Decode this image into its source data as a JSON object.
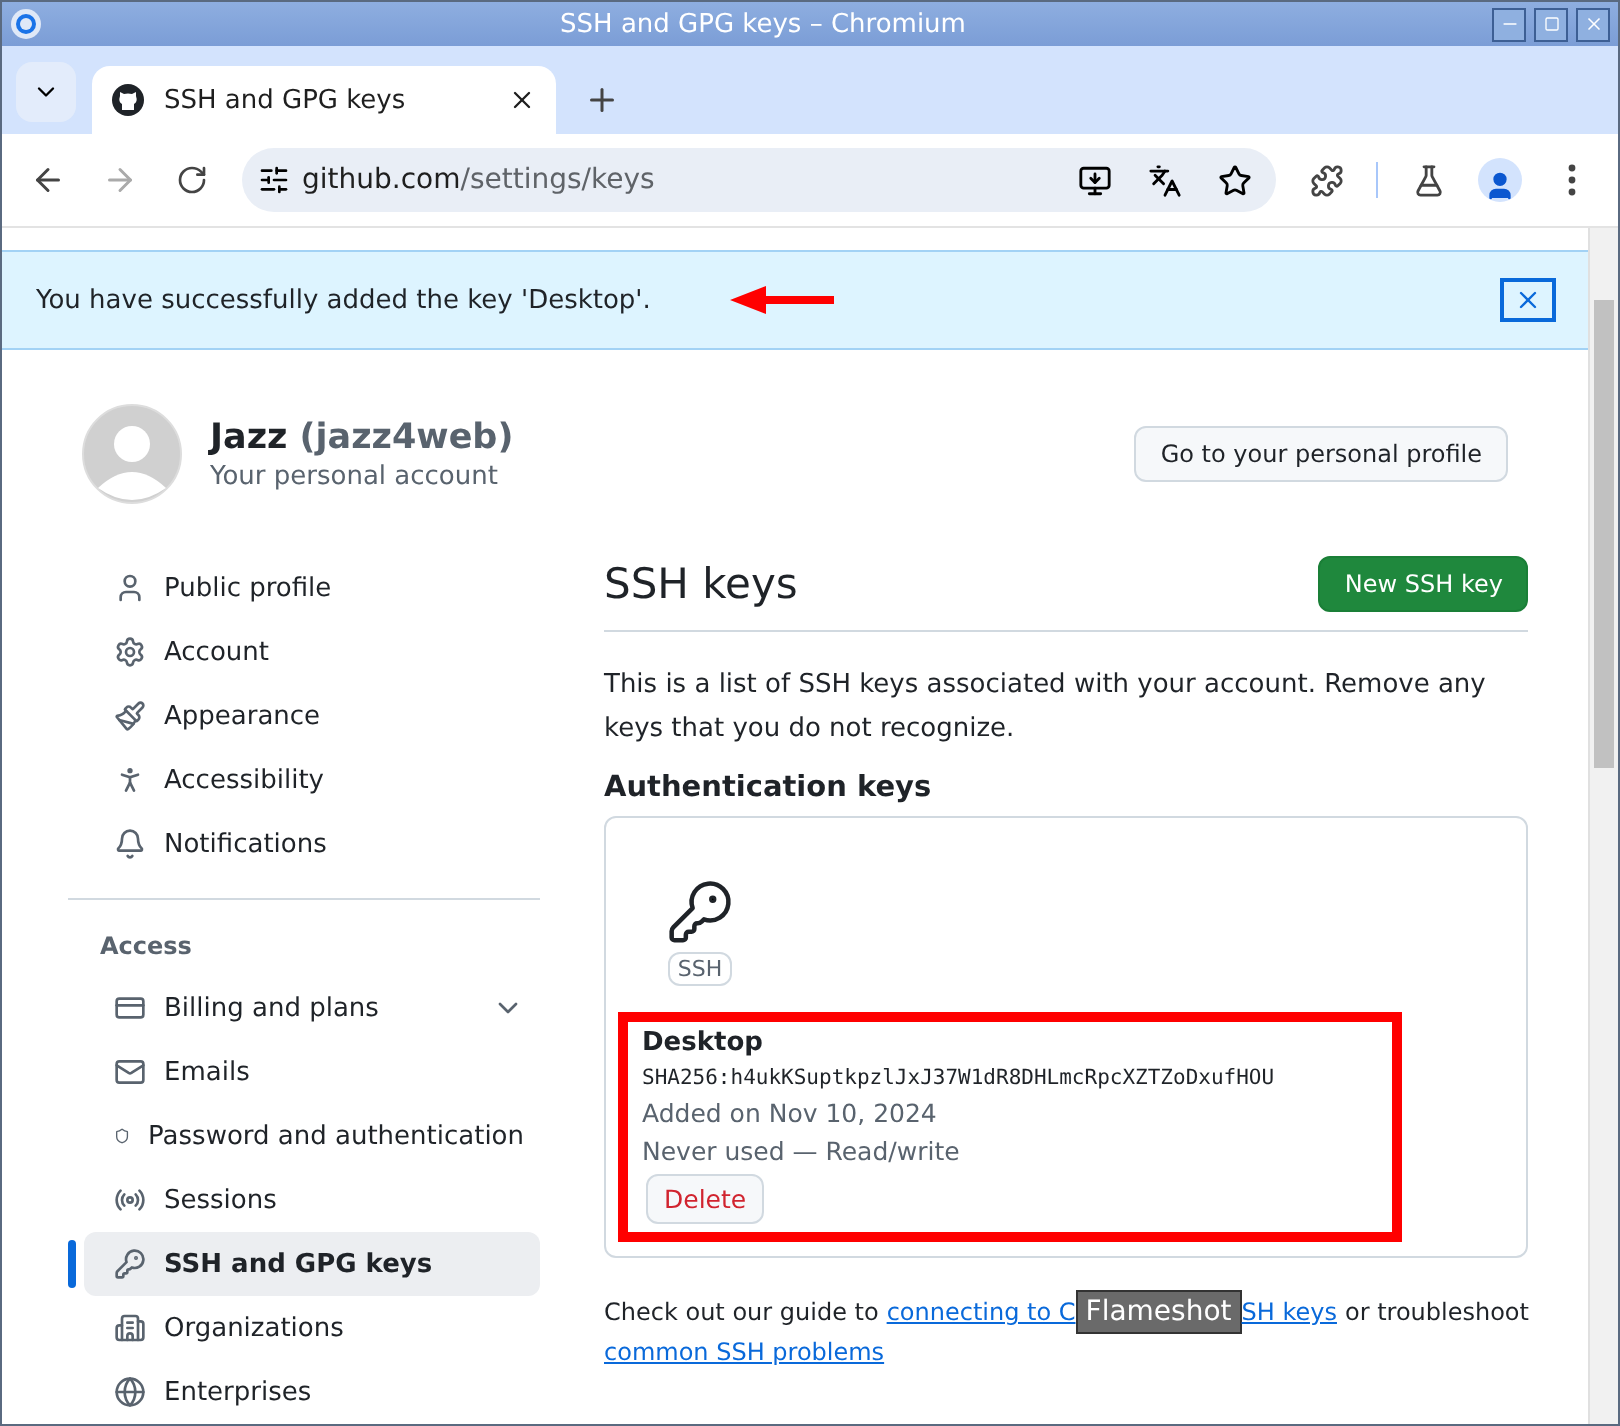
{
  "window": {
    "title": "SSH and GPG keys – Chromium"
  },
  "tabs": [
    {
      "label": "SSH and GPG keys",
      "selected": true
    }
  ],
  "address_bar": {
    "host": "github.com",
    "path": "/settings/keys"
  },
  "banner": {
    "message": "You have successfully added the key 'Desktop'."
  },
  "profile": {
    "name": "Jazz",
    "handle": "(jazz4web)",
    "subtitle": "Your personal account",
    "button": "Go to your personal profile"
  },
  "sidebar": {
    "items": [
      {
        "label": "Public profile",
        "selected": false
      },
      {
        "label": "Account",
        "selected": false
      },
      {
        "label": "Appearance",
        "selected": false
      },
      {
        "label": "Accessibility",
        "selected": false
      },
      {
        "label": "Notifications",
        "selected": false
      }
    ],
    "section": "Access",
    "access_items": [
      {
        "label": "Billing and plans",
        "selected": false,
        "expandable": true
      },
      {
        "label": "Emails",
        "selected": false,
        "expandable": false
      },
      {
        "label": "Password and authentication",
        "selected": false,
        "expandable": false
      },
      {
        "label": "Sessions",
        "selected": false,
        "expandable": false
      },
      {
        "label": "SSH and GPG keys",
        "selected": true,
        "expandable": false
      },
      {
        "label": "Organizations",
        "selected": false,
        "expandable": false
      },
      {
        "label": "Enterprises",
        "selected": false,
        "expandable": false
      }
    ]
  },
  "main": {
    "title": "SSH keys",
    "new_button": "New SSH key",
    "description": "This is a list of SSH keys associated with your account. Remove any keys that you do not recognize.",
    "section": "Authentication keys",
    "keys": [
      {
        "badge": "SSH",
        "name": "Desktop",
        "fingerprint": "SHA256:h4ukKSuptkpzlJxJ37W1dR8DHLmcRpcXZTZoDxufHOU",
        "added": "Added on Nov 10, 2024",
        "usage": "Never used — Read/write",
        "delete": "Delete"
      }
    ],
    "guide": {
      "prefix": "Check out our guide to ",
      "link_start": "connecting to C",
      "link_end": "SH keys",
      "middle": " or troubleshoot",
      "second_link": "common SSH problems"
    }
  },
  "tooltip": {
    "text": "Flameshot"
  }
}
